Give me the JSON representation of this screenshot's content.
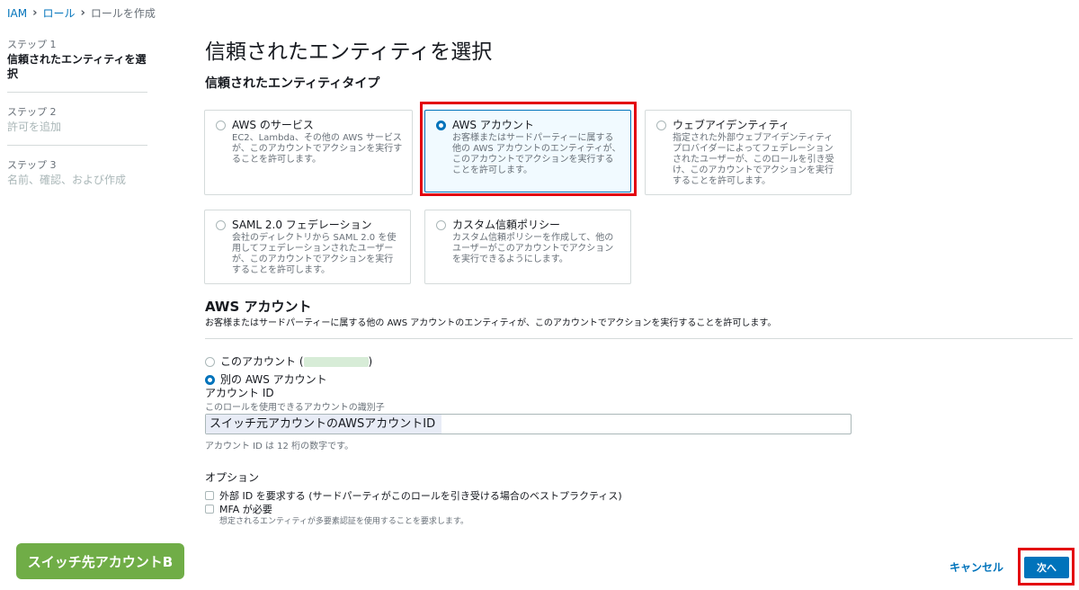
{
  "breadcrumb": {
    "root": "IAM",
    "parent": "ロール",
    "current": "ロールを作成"
  },
  "steps": [
    {
      "num": "ステップ 1",
      "title": "信頼されたエンティティを選択"
    },
    {
      "num": "ステップ 2",
      "title": "許可を追加"
    },
    {
      "num": "ステップ 3",
      "title": "名前、確認、および作成"
    }
  ],
  "page_title": "信頼されたエンティティを選択",
  "entity_type_heading": "信頼されたエンティティタイプ",
  "entity_types": [
    {
      "title": "AWS のサービス",
      "desc": "EC2、Lambda、その他の AWS サービスが、このアカウントでアクションを実行することを許可します。",
      "selected": false
    },
    {
      "title": "AWS アカウント",
      "desc": "お客様またはサードパーティーに属する他の AWS アカウントのエンティティが、このアカウントでアクションを実行することを許可します。",
      "selected": true
    },
    {
      "title": "ウェブアイデンティティ",
      "desc": "指定された外部ウェブアイデンティティプロバイダーによってフェデレーションされたユーザーが、このロールを引き受け、このアカウントでアクションを実行することを許可します。",
      "selected": false
    },
    {
      "title": "SAML 2.0 フェデレーション",
      "desc": "会社のディレクトリから SAML 2.0 を使用してフェデレーションされたユーザーが、このアカウントでアクションを実行することを許可します。",
      "selected": false
    },
    {
      "title": "カスタム信頼ポリシー",
      "desc": "カスタム信頼ポリシーを作成して、他のユーザーがこのアカウントでアクションを実行できるようにします。",
      "selected": false
    }
  ],
  "aws_account": {
    "heading": "AWS アカウント",
    "desc": "お客様またはサードパーティーに属する他の AWS アカウントのエンティティが、このアカウントでアクションを実行することを許可します。",
    "this_account_prefix": "このアカウント (",
    "this_account_suffix": ")",
    "other_account_label": "別の AWS アカウント",
    "account_id_label": "アカウント ID",
    "account_id_help": "このロールを使用できるアカウントの識別子",
    "account_id_value": "スイッチ元アカウントのAWSアカウントID",
    "account_id_note": "アカウント ID は 12 桁の数字です。"
  },
  "options": {
    "heading": "オプション",
    "external_id_label": "外部 ID を要求する (サードパーティがこのロールを引き受ける場合のベストプラクティス)",
    "mfa_label": "MFA が必要",
    "mfa_desc": "想定されるエンティティが多要素認証を使用することを要求します。"
  },
  "account_badge": "スイッチ先アカウントB",
  "buttons": {
    "cancel": "キャンセル",
    "next": "次へ"
  },
  "colors": {
    "accent": "#0073bb",
    "highlight": "#e3000f",
    "badge": "#70ad47"
  }
}
